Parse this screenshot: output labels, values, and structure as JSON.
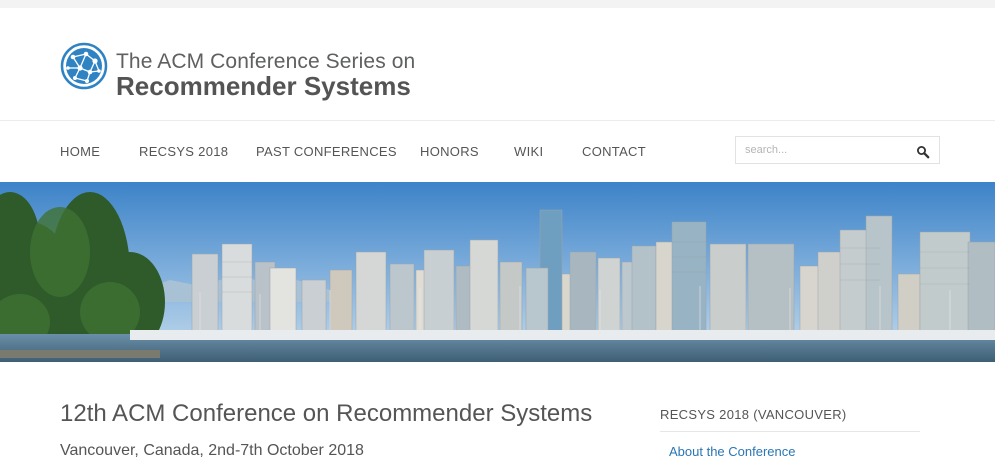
{
  "header": {
    "logo_line1": "The ACM Conference Series on",
    "logo_line2": "Recommender Systems",
    "logo_icon": "network-globe-icon",
    "brand_color": "#2f83c3"
  },
  "nav": {
    "items": [
      {
        "label": "HOME"
      },
      {
        "label": "RECSYS 2018"
      },
      {
        "label": "PAST CONFERENCES"
      },
      {
        "label": "HONORS"
      },
      {
        "label": "WIKI"
      },
      {
        "label": "CONTACT"
      }
    ]
  },
  "search": {
    "placeholder": "search...",
    "value": "",
    "icon": "magnifier-icon"
  },
  "banner": {
    "subject": "vancouver-skyline-photo"
  },
  "main": {
    "title": "12th ACM Conference on Recommender Systems",
    "subtitle": "Vancouver, Canada, 2nd-7th October 2018"
  },
  "sidebar": {
    "heading": "RECSYS 2018 (VANCOUVER)",
    "links": [
      {
        "label": "About the Conference"
      }
    ],
    "link_color": "#2a76b3"
  }
}
